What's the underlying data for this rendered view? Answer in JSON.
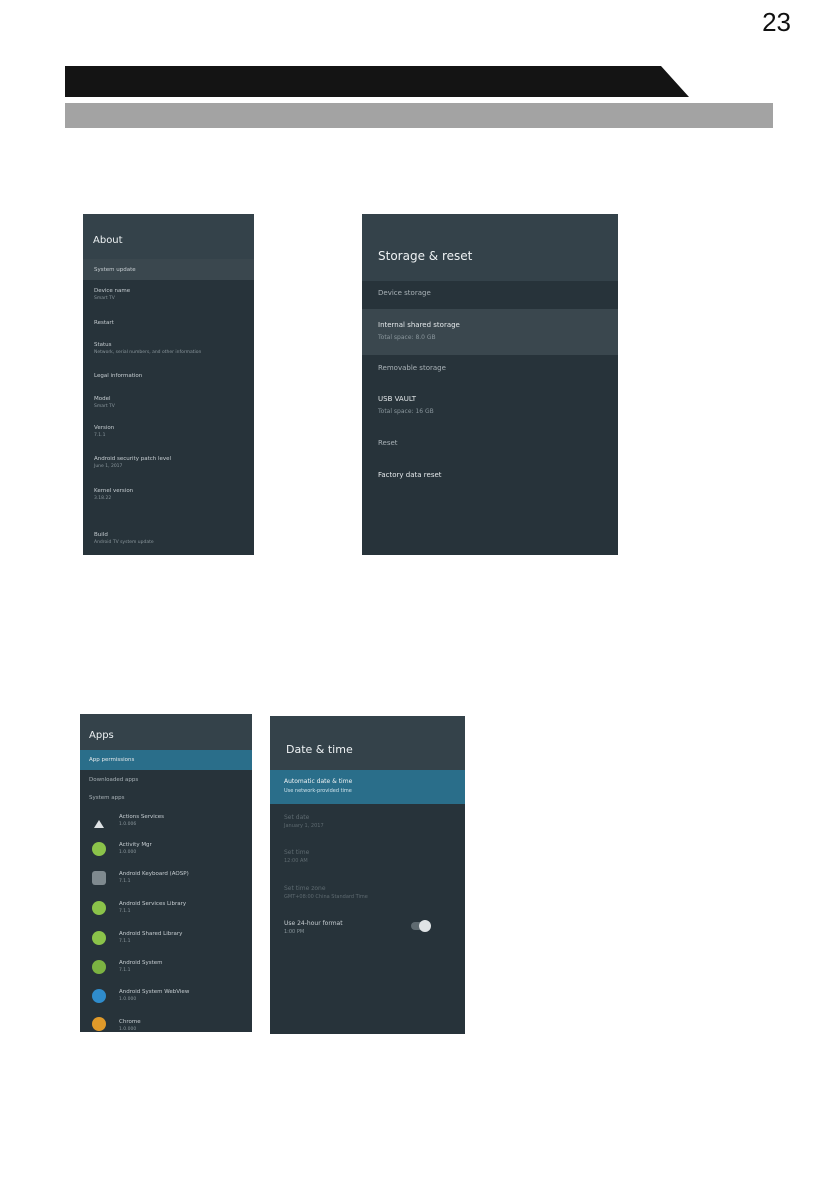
{
  "page_number": "23",
  "about": {
    "title": "About",
    "items": [
      {
        "label": "System update",
        "sub": ""
      },
      {
        "label": "Device name",
        "sub": "Smart TV"
      },
      {
        "label": "Restart",
        "sub": ""
      },
      {
        "label": "Status",
        "sub": "Network, serial numbers, and other information"
      },
      {
        "label": "Legal information",
        "sub": ""
      },
      {
        "label": "Model",
        "sub": "Smart TV"
      },
      {
        "label": "Version",
        "sub": "7.1.1"
      },
      {
        "label": "Android security patch level",
        "sub": "June 1, 2017"
      },
      {
        "label": "Kernel version",
        "sub": "3.18.22"
      },
      {
        "label": "Build",
        "sub": "Android TV system update"
      }
    ]
  },
  "storage": {
    "title": "Storage & reset",
    "items": [
      {
        "label": "Device storage",
        "sub": ""
      },
      {
        "label": "Internal shared storage",
        "sub": "Total space: 8.0 GB"
      },
      {
        "label": "Removable storage",
        "sub": ""
      },
      {
        "label": "USB VAULT",
        "sub": "Total space: 16 GB"
      },
      {
        "label": "Reset",
        "sub": ""
      },
      {
        "label": "Factory data reset",
        "sub": ""
      }
    ]
  },
  "apps": {
    "title": "Apps",
    "menu": [
      "App permissions",
      "Downloaded apps",
      "System apps"
    ],
    "list": [
      {
        "name": "Actions Services",
        "sub": "1.0.006"
      },
      {
        "name": "Activity Mgr",
        "sub": "1.0.000"
      },
      {
        "name": "Android Keyboard (AOSP)",
        "sub": "7.1.1"
      },
      {
        "name": "Android Services Library",
        "sub": "7.1.1"
      },
      {
        "name": "Android Shared Library",
        "sub": "7.1.1"
      },
      {
        "name": "Android System",
        "sub": "7.1.1"
      },
      {
        "name": "Android System WebView",
        "sub": "1.0.000"
      },
      {
        "name": "Chrome",
        "sub": "1.0.000"
      }
    ]
  },
  "datetime": {
    "title": "Date & time",
    "items": [
      {
        "label": "Automatic date & time",
        "sub": "Use network-provided time"
      },
      {
        "label": "Set date",
        "sub": "January 1, 2017"
      },
      {
        "label": "Set time",
        "sub": "12:00 AM"
      },
      {
        "label": "Set time zone",
        "sub": "GMT+08:00 China Standard Time"
      },
      {
        "label": "Use 24-hour format",
        "sub": "1:00 PM"
      }
    ]
  },
  "colors": {
    "panel": "#27333a",
    "header": "#34424a",
    "highlight": "#3a474e",
    "accent": "#2a6e8a"
  },
  "icons": [
    "triangle-icon",
    "android-icon",
    "keyboard-icon",
    "android-icon",
    "android-icon",
    "gear-icon",
    "globe-icon",
    "chrome-icon"
  ]
}
